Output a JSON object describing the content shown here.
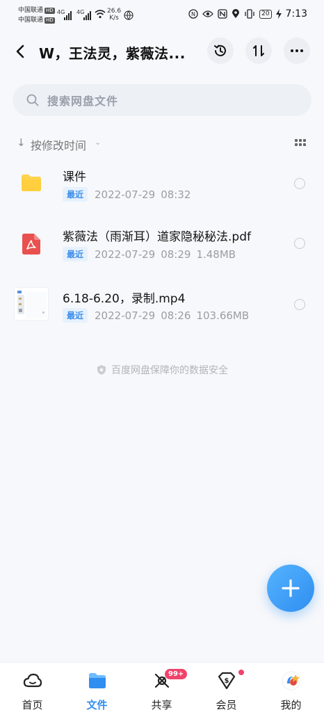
{
  "status_bar": {
    "carrier1": "中国联通",
    "carrier2": "中国联通",
    "hd": "HD",
    "net1": "4G",
    "net2": "4G",
    "speed_value": "26.6",
    "speed_unit": "K/s",
    "nfc": "N",
    "battery": "20",
    "time": "7:13"
  },
  "header": {
    "title": "W，王法灵，紫薇法..."
  },
  "search": {
    "placeholder": "搜索网盘文件"
  },
  "sort": {
    "label": "按修改时间"
  },
  "files": [
    {
      "name": "课件",
      "tag": "最近",
      "date": "2022-07-29",
      "time": "08:32",
      "size": "",
      "type": "folder"
    },
    {
      "name": "紫薇法（雨渐耳）道家隐秘秘法.pdf",
      "tag": "最近",
      "date": "2022-07-29",
      "time": "08:29",
      "size": "1.48MB",
      "type": "pdf"
    },
    {
      "name": "6.18-6.20，录制.mp4",
      "tag": "最近",
      "date": "2022-07-29",
      "time": "08:26",
      "size": "103.66MB",
      "type": "video"
    }
  ],
  "safety_note": "百度网盘保障你的数据安全",
  "tabs": [
    {
      "label": "首页",
      "active": false
    },
    {
      "label": "文件",
      "active": true
    },
    {
      "label": "共享",
      "badge": "99+"
    },
    {
      "label": "会员",
      "dot": true
    },
    {
      "label": "我的"
    }
  ],
  "colors": {
    "accent": "#2f8ef0",
    "badge": "#f0436b",
    "folder": "#ffd34d",
    "pdf": "#e8514f"
  }
}
